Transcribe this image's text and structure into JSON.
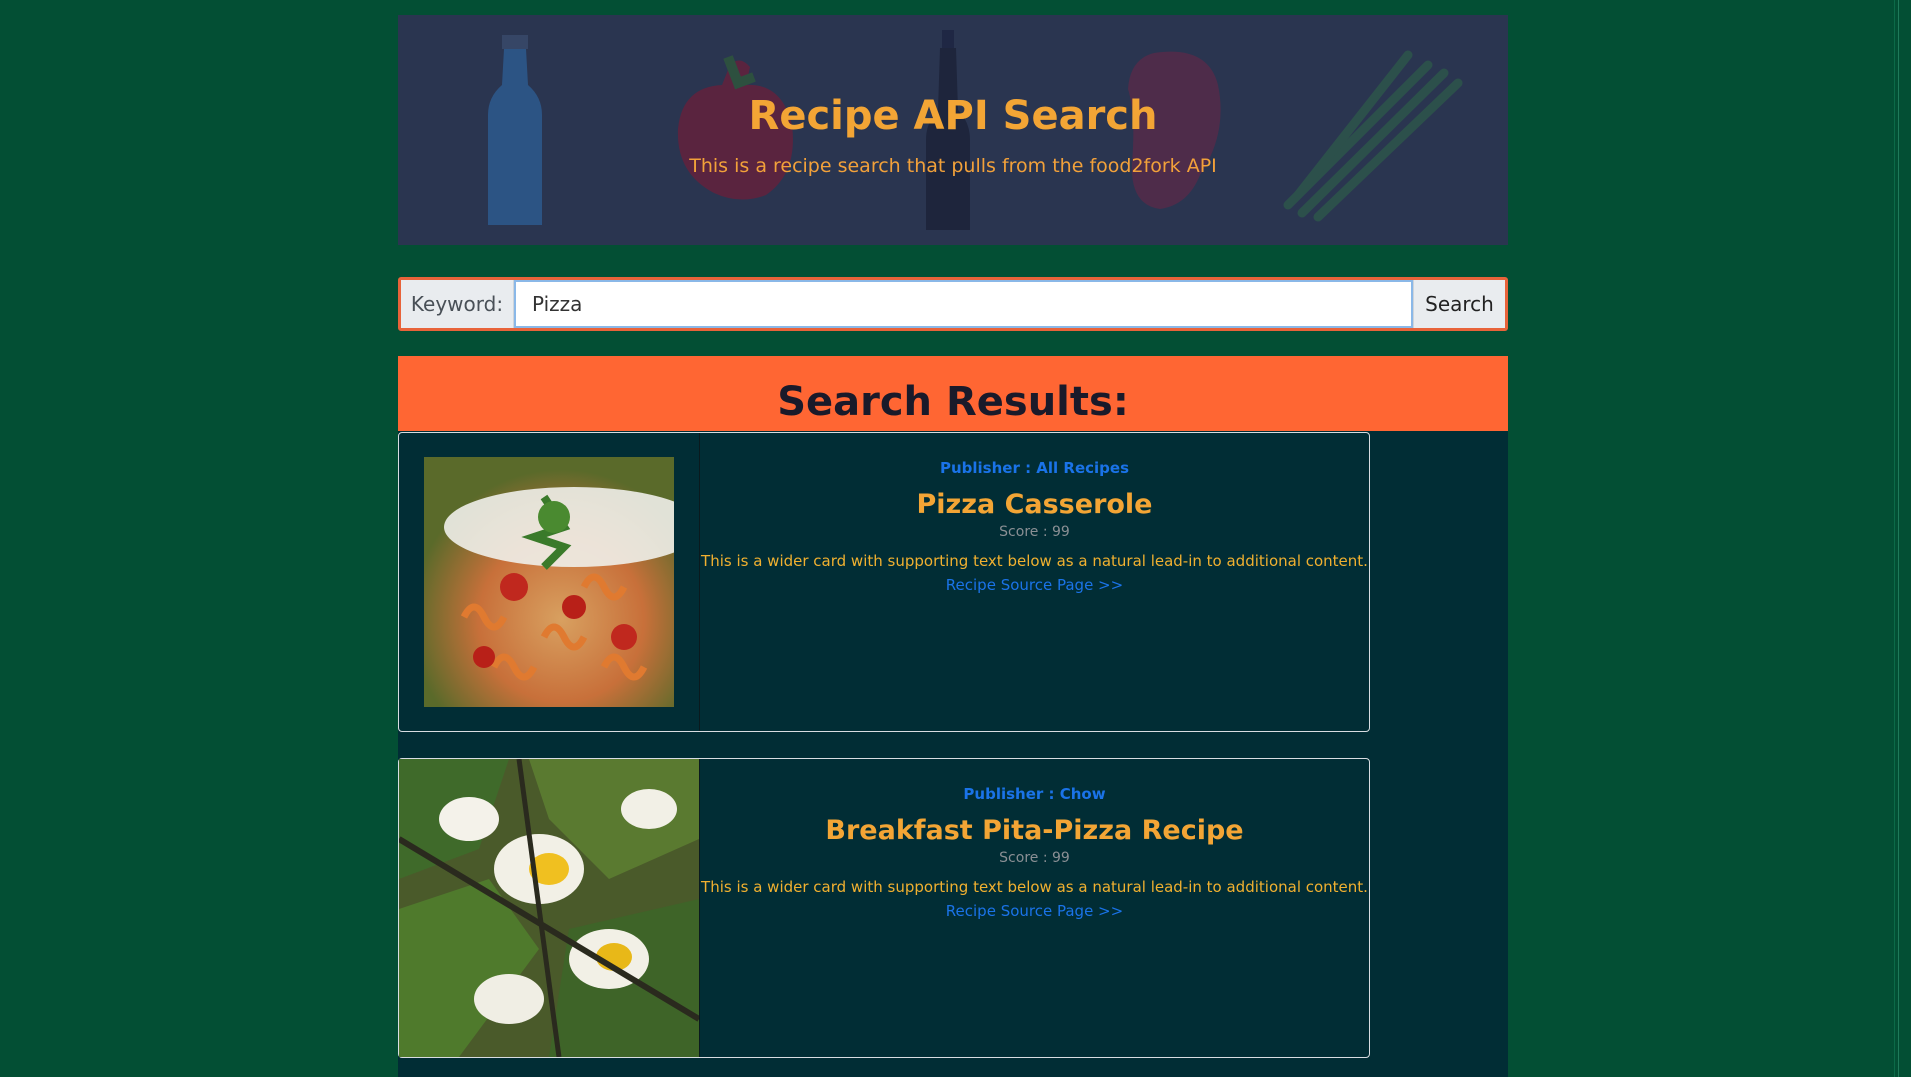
{
  "header": {
    "title": "Recipe API Search",
    "subtitle": "This is a recipe search that pulls from the food2fork API"
  },
  "search": {
    "label": "Keyword:",
    "value": "Pizza",
    "button_label": "Search"
  },
  "results": {
    "heading": "Search Results:",
    "cards": [
      {
        "publisher": "Publisher : All Recipes",
        "title": "Pizza Casserole",
        "score": "Score : 99",
        "description": "This is a wider card with supporting text below as a natural lead-in to additional content.",
        "link_label": "Recipe Source Page >>"
      },
      {
        "publisher": "Publisher : Chow",
        "title": "Breakfast Pita-Pizza Recipe",
        "score": "Score : 99",
        "description": "This is a wider card with supporting text below as a natural lead-in to additional content.",
        "link_label": "Recipe Source Page >>"
      }
    ]
  },
  "colors": {
    "page_bg": "#034f34",
    "hero_bg": "#2a3550",
    "accent_orange": "#ff6633",
    "title_gold": "#f3a535",
    "link_blue": "#1a73e8",
    "card_bg": "#012d35"
  }
}
